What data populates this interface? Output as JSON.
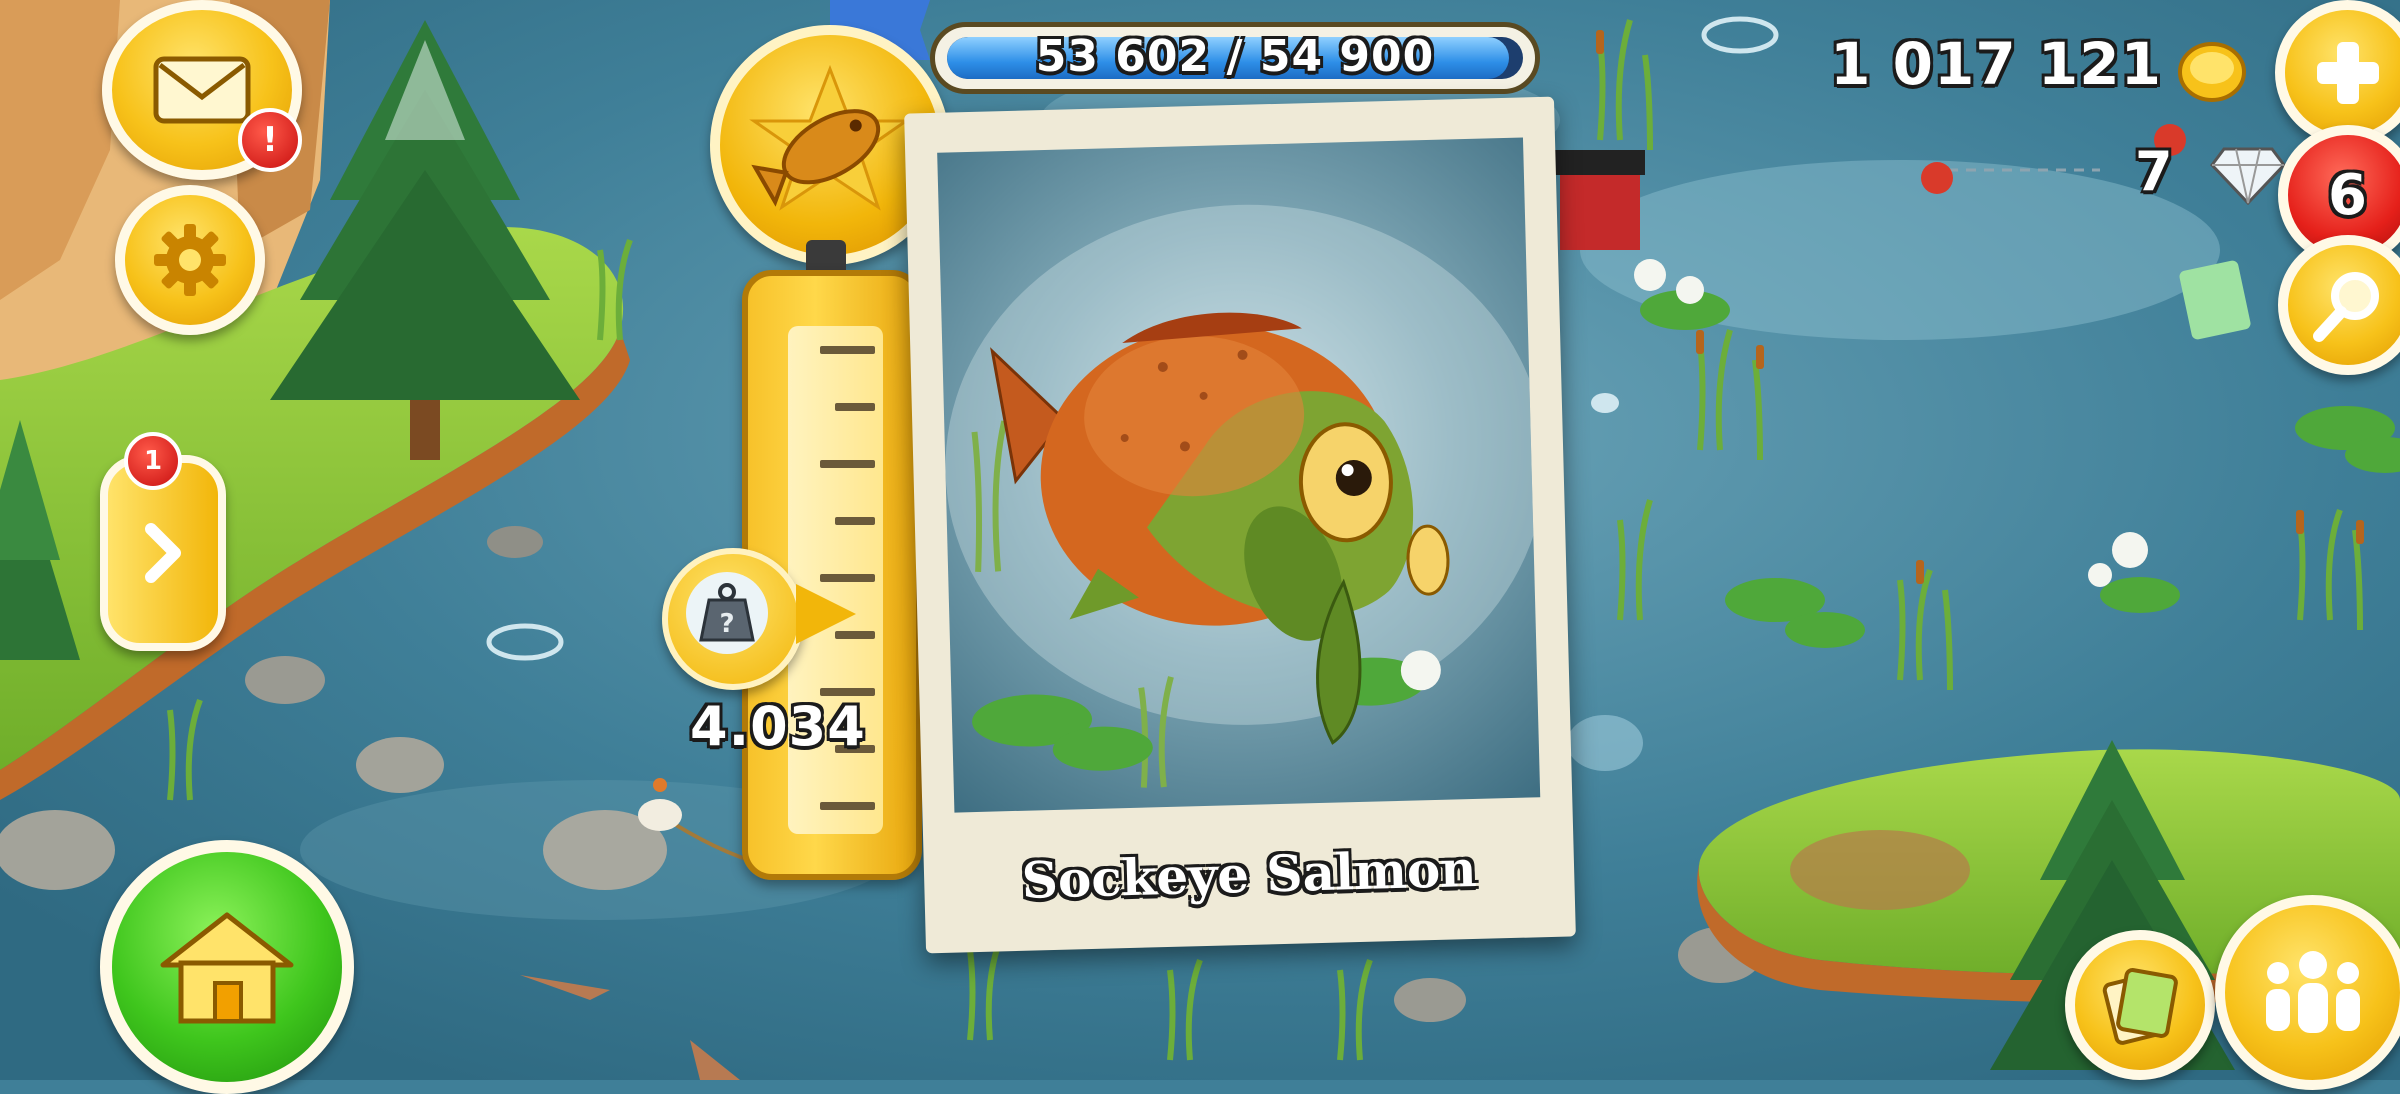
{
  "hud": {
    "xp": "53 602 / 54 900",
    "xp_fraction": 0.976,
    "coins": "1 017 121",
    "diamonds": "7",
    "notification_count": "6",
    "mail_alert": "!",
    "side_badge": "1"
  },
  "card": {
    "fish_name": "Sockeye Salmon",
    "weight": "4.034"
  },
  "icons": {
    "mail": "mail-icon",
    "settings": "gear-icon",
    "arrow": "chevron-right-icon",
    "home": "home-icon",
    "plus": "plus-icon",
    "search": "magnifier-icon",
    "friends": "friends-icon",
    "cards": "cards-icon",
    "fish_medal": "fish-medal-icon",
    "weight": "weight-icon"
  }
}
